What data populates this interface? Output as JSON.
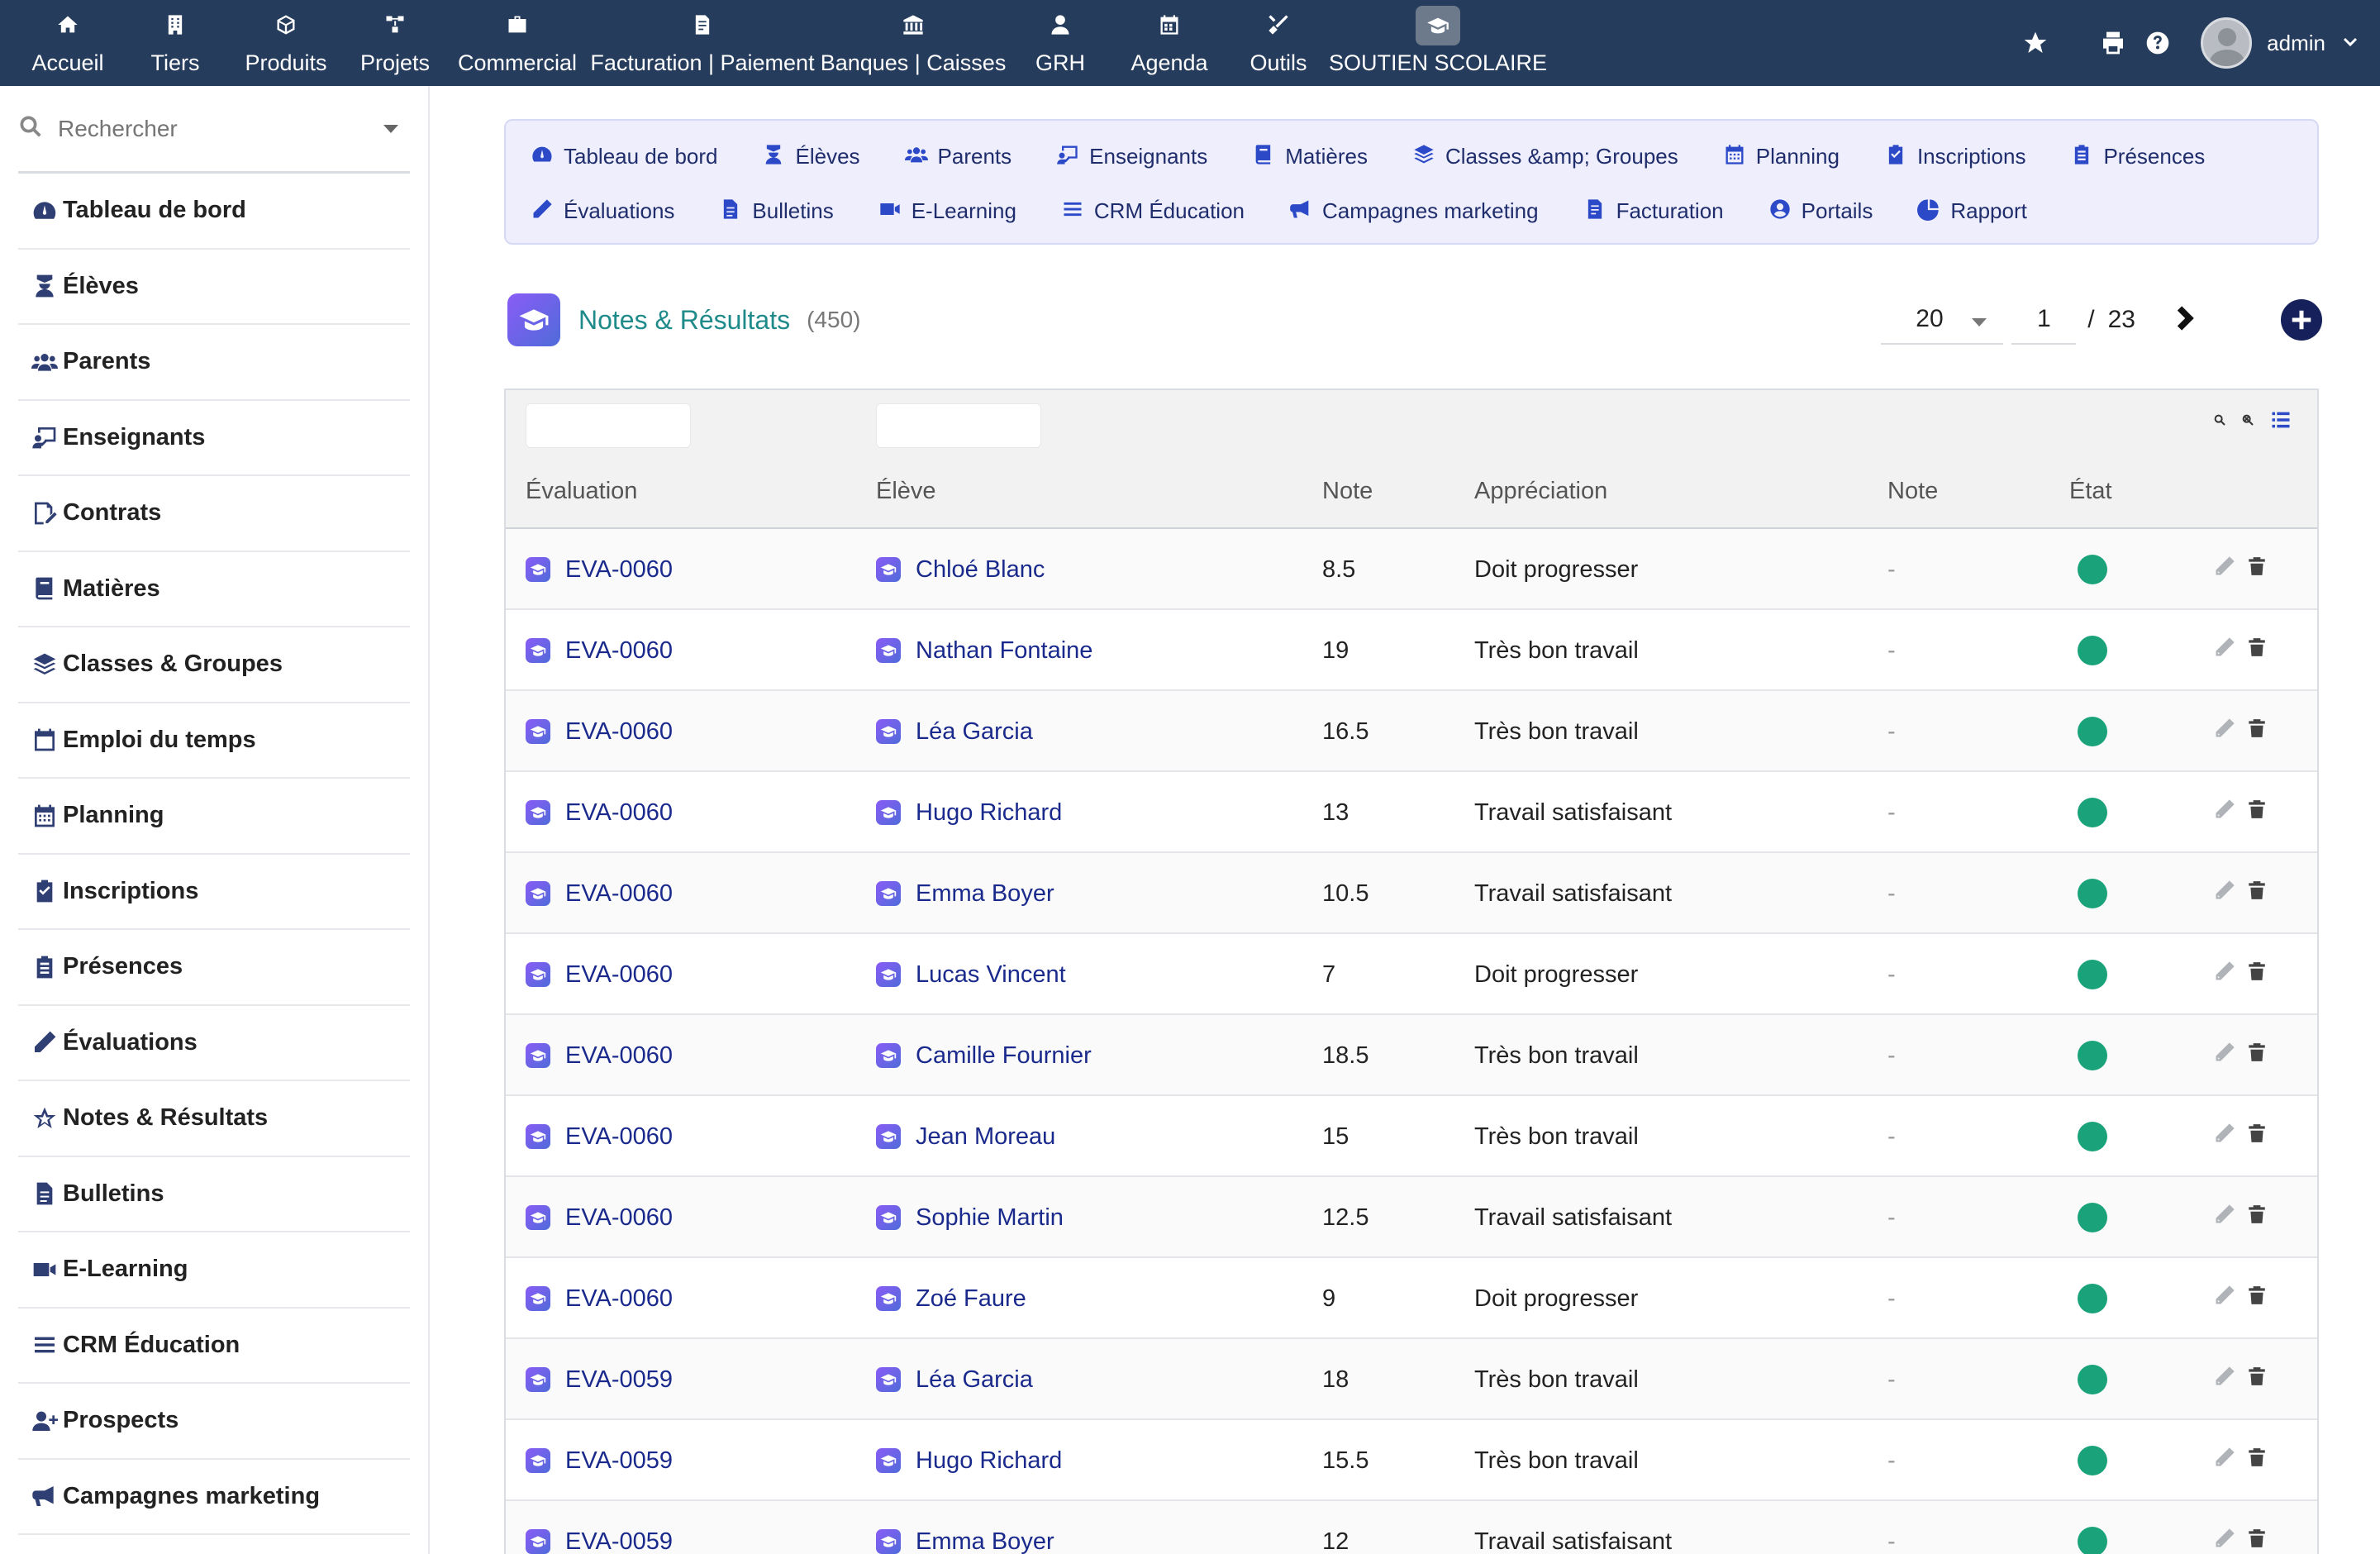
{
  "topnav": {
    "items": [
      {
        "label": "Accueil",
        "icon": "home-icon"
      },
      {
        "label": "Tiers",
        "icon": "building-icon"
      },
      {
        "label": "Produits",
        "icon": "cube-icon"
      },
      {
        "label": "Projets",
        "icon": "sitemap-icon"
      },
      {
        "label": "Commercial",
        "icon": "briefcase-icon"
      },
      {
        "label": "Facturation | Paiement",
        "icon": "invoice-icon"
      },
      {
        "label": "Banques | Caisses",
        "icon": "bank-icon"
      },
      {
        "label": "GRH",
        "icon": "user-tie-icon"
      },
      {
        "label": "Agenda",
        "icon": "calendar-icon"
      },
      {
        "label": "Outils",
        "icon": "tools-icon"
      },
      {
        "label": "SOUTIEN SCOLAIRE",
        "icon": "graduation-cap-icon"
      }
    ],
    "user": "admin"
  },
  "sidebar": {
    "search_placeholder": "Rechercher",
    "items": [
      {
        "label": "Tableau de bord"
      },
      {
        "label": "Élèves"
      },
      {
        "label": "Parents"
      },
      {
        "label": "Enseignants"
      },
      {
        "label": "Contrats"
      },
      {
        "label": "Matières"
      },
      {
        "label": "Classes & Groupes"
      },
      {
        "label": "Emploi du temps"
      },
      {
        "label": "Planning"
      },
      {
        "label": "Inscriptions"
      },
      {
        "label": "Présences"
      },
      {
        "label": "Évaluations"
      },
      {
        "label": "Notes & Résultats"
      },
      {
        "label": "Bulletins"
      },
      {
        "label": "E-Learning"
      },
      {
        "label": "CRM Éducation"
      },
      {
        "label": "Prospects"
      },
      {
        "label": "Campagnes marketing"
      }
    ]
  },
  "module_tabs": [
    {
      "label": "Tableau de bord"
    },
    {
      "label": "Élèves"
    },
    {
      "label": "Parents"
    },
    {
      "label": "Enseignants"
    },
    {
      "label": "Matières"
    },
    {
      "label": "Classes &amp; Groupes"
    },
    {
      "label": "Planning"
    },
    {
      "label": "Inscriptions"
    },
    {
      "label": "Présences"
    },
    {
      "label": "Évaluations"
    },
    {
      "label": "Bulletins"
    },
    {
      "label": "E-Learning"
    },
    {
      "label": "CRM Éducation"
    },
    {
      "label": "Campagnes marketing"
    },
    {
      "label": "Facturation"
    },
    {
      "label": "Portails"
    },
    {
      "label": "Rapport"
    }
  ],
  "page": {
    "title": "Notes & Résultats",
    "count": "(450)",
    "per_page": "20",
    "current_page": "1",
    "separator": "/",
    "total_pages": "23"
  },
  "table": {
    "columns": [
      "Évaluation",
      "Élève",
      "Note",
      "Appréciation",
      "Note",
      "État"
    ],
    "rows": [
      {
        "evaluation": "EVA-0060",
        "eleve": "Chloé Blanc",
        "note": "8.5",
        "appreciation": "Doit progresser",
        "note2": "-",
        "etat": "active"
      },
      {
        "evaluation": "EVA-0060",
        "eleve": "Nathan Fontaine",
        "note": "19",
        "appreciation": "Très bon travail",
        "note2": "-",
        "etat": "active"
      },
      {
        "evaluation": "EVA-0060",
        "eleve": "Léa Garcia",
        "note": "16.5",
        "appreciation": "Très bon travail",
        "note2": "-",
        "etat": "active"
      },
      {
        "evaluation": "EVA-0060",
        "eleve": "Hugo Richard",
        "note": "13",
        "appreciation": "Travail satisfaisant",
        "note2": "-",
        "etat": "active"
      },
      {
        "evaluation": "EVA-0060",
        "eleve": "Emma Boyer",
        "note": "10.5",
        "appreciation": "Travail satisfaisant",
        "note2": "-",
        "etat": "active"
      },
      {
        "evaluation": "EVA-0060",
        "eleve": "Lucas Vincent",
        "note": "7",
        "appreciation": "Doit progresser",
        "note2": "-",
        "etat": "active"
      },
      {
        "evaluation": "EVA-0060",
        "eleve": "Camille Fournier",
        "note": "18.5",
        "appreciation": "Très bon travail",
        "note2": "-",
        "etat": "active"
      },
      {
        "evaluation": "EVA-0060",
        "eleve": "Jean Moreau",
        "note": "15",
        "appreciation": "Très bon travail",
        "note2": "-",
        "etat": "active"
      },
      {
        "evaluation": "EVA-0060",
        "eleve": "Sophie Martin",
        "note": "12.5",
        "appreciation": "Travail satisfaisant",
        "note2": "-",
        "etat": "active"
      },
      {
        "evaluation": "EVA-0060",
        "eleve": "Zoé Faure",
        "note": "9",
        "appreciation": "Doit progresser",
        "note2": "-",
        "etat": "active"
      },
      {
        "evaluation": "EVA-0059",
        "eleve": "Léa Garcia",
        "note": "18",
        "appreciation": "Très bon travail",
        "note2": "-",
        "etat": "active"
      },
      {
        "evaluation": "EVA-0059",
        "eleve": "Hugo Richard",
        "note": "15.5",
        "appreciation": "Très bon travail",
        "note2": "-",
        "etat": "active"
      },
      {
        "evaluation": "EVA-0059",
        "eleve": "Emma Boyer",
        "note": "12",
        "appreciation": "Travail satisfaisant",
        "note2": "-",
        "etat": "active"
      }
    ]
  },
  "colors": {
    "topbar": "#263c5c",
    "accent": "#2c49c7",
    "title": "#1f8a8a",
    "status_active": "#1aa37a"
  }
}
